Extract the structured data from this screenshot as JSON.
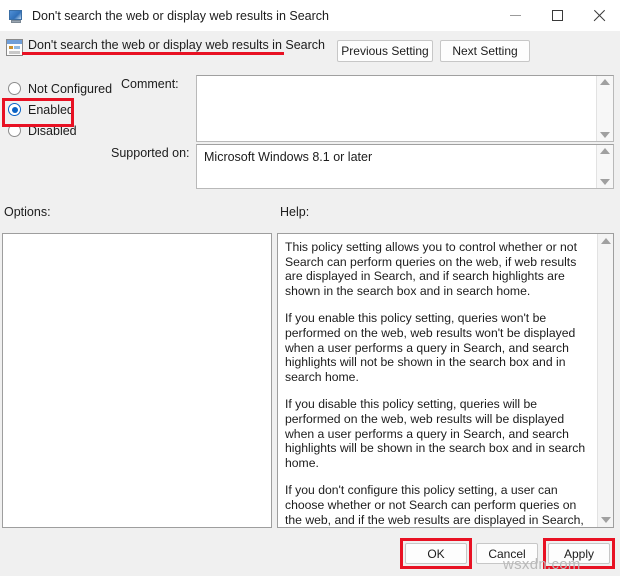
{
  "window": {
    "title": "Don't search the web or display web results in Search",
    "icon": "policy-window-icon",
    "controls": {
      "minimize": "minimize-icon",
      "maximize": "maximize-icon",
      "close": "close-icon"
    }
  },
  "header": {
    "icon": "policy-setting-icon",
    "title": "Don't search the web or display web results in Search",
    "previous_setting_label": "Previous Setting",
    "next_setting_label": "Next Setting"
  },
  "state": {
    "options": [
      {
        "label": "Not Configured",
        "checked": false
      },
      {
        "label": "Enabled",
        "checked": true
      },
      {
        "label": "Disabled",
        "checked": false
      }
    ],
    "selected": "Enabled"
  },
  "comment": {
    "label": "Comment:",
    "value": "",
    "placeholder": ""
  },
  "supported_on": {
    "label": "Supported on:",
    "value": "Microsoft Windows 8.1 or later"
  },
  "options_panel": {
    "label": "Options:",
    "content": ""
  },
  "help_panel": {
    "label": "Help:",
    "paragraphs": [
      "This policy setting allows you to control whether or not Search can perform queries on the web, if web results are displayed in Search, and if search highlights are shown in the search box and in search home.",
      "If you enable this policy setting, queries won't be performed on the web, web results won't be displayed when a user performs a query in Search, and search highlights will not be shown in the search box and in search home.",
      "If you disable this policy setting, queries will be performed on the web, web results will be displayed when a user performs a query in Search, and search highlights will be shown in the search box and in search home.",
      "If you don't configure this policy setting, a user can choose whether or not Search can perform queries on the web, and if the web results are displayed in Search, and if search highlights are shown in the search box and in search home."
    ]
  },
  "footer": {
    "ok_label": "OK",
    "cancel_label": "Cancel",
    "apply_label": "Apply"
  },
  "annotations": {
    "color": "#e81123",
    "highlighted": [
      "header-title-underline",
      "enabled-radio",
      "ok-button",
      "apply-button"
    ]
  },
  "watermark": "wsxdn.com"
}
